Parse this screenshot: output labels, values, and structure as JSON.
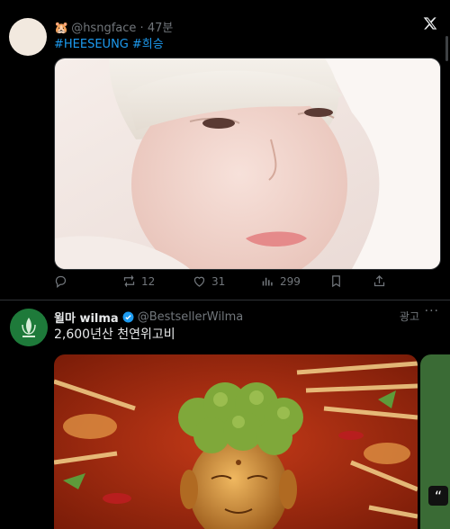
{
  "tweet1": {
    "handle": "@hsngface",
    "separator": "·",
    "time": "47분",
    "hashtags": [
      "#HEESEUNG",
      "#희승"
    ],
    "metrics": {
      "retweets": "12",
      "likes": "31",
      "views": "299"
    }
  },
  "tweet2": {
    "display_name": "윌마 wilma",
    "handle": "@BestsellerWilma",
    "ad_label": "광고",
    "more": "···",
    "text": "2,600년산 천연위고비",
    "quote_mark": "“"
  },
  "icons": {
    "x_logo": "x-logo-icon",
    "reply": "reply-icon",
    "retweet": "retweet-icon",
    "like": "heart-icon",
    "views": "views-icon",
    "bookmark": "bookmark-icon",
    "share": "share-icon",
    "verified": "verified-badge-icon"
  },
  "colors": {
    "background": "#000000",
    "text": "#e7e9ea",
    "muted": "#71767b",
    "accent": "#1d9bf0",
    "divider": "#2f3336"
  }
}
